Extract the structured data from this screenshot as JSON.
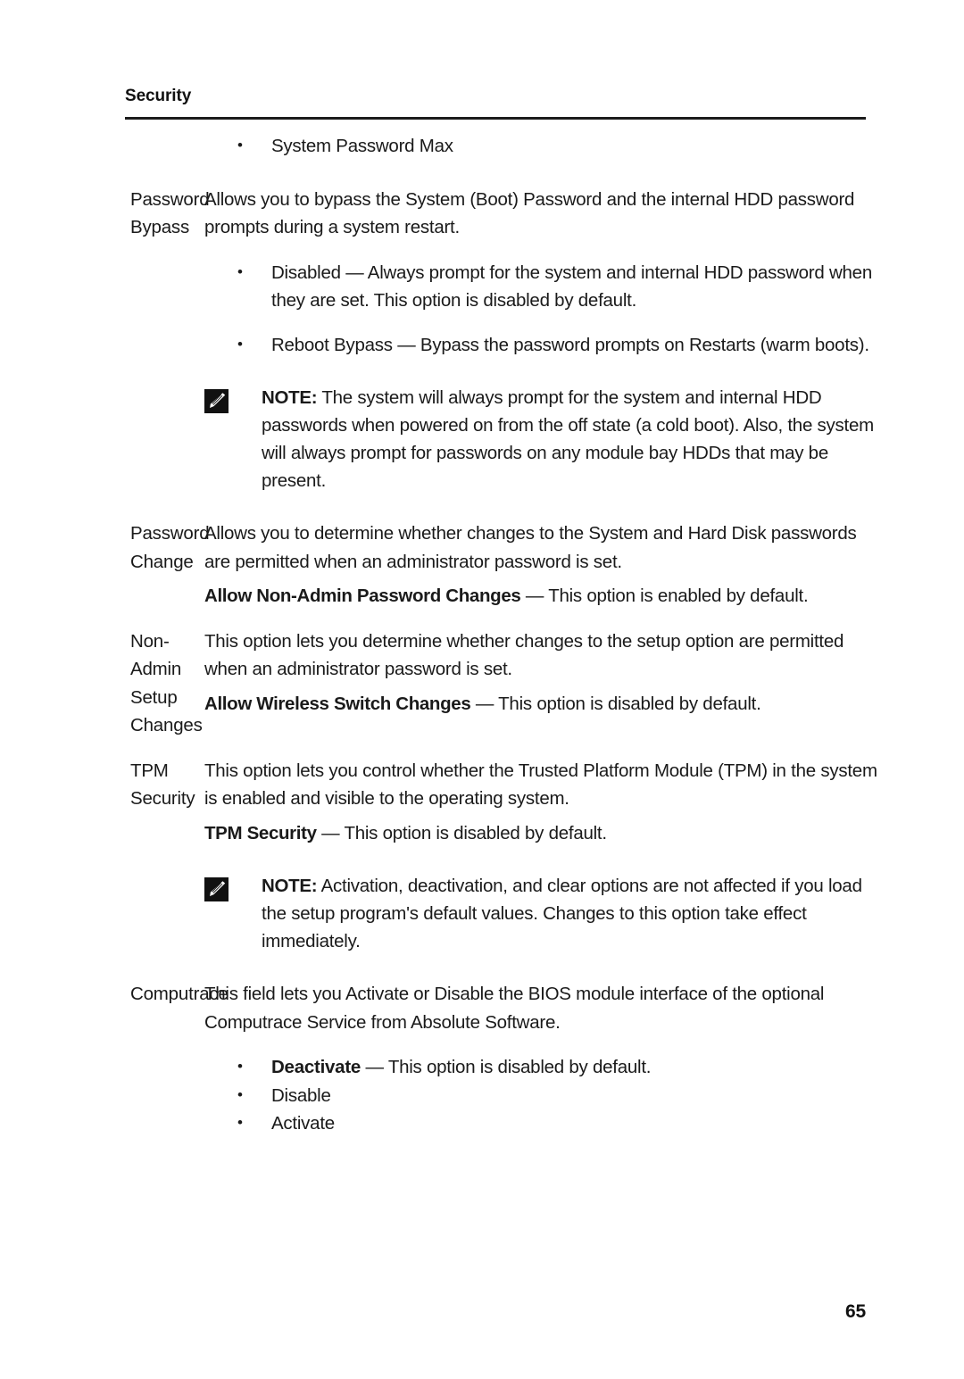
{
  "header": {
    "title": "Security"
  },
  "footer": {
    "page_number": "65"
  },
  "icons": {
    "note_icon_name": "pencil-note-icon"
  },
  "continued_bullet": {
    "text": "System Password Max"
  },
  "rows": [
    {
      "label": "Password Bypass",
      "paragraph": "Allows you to bypass the System (Boot) Password and the internal HDD password prompts during a system restart.",
      "bullets": [
        "Disabled — Always prompt for the system and internal HDD password when they are set. This option is disabled by default.",
        "Reboot Bypass — Bypass the password prompts on Restarts (warm boots)."
      ],
      "note": {
        "label": "NOTE:",
        "text": " The system will always prompt for the system and internal HDD passwords when powered on from the off state (a cold boot). Also, the system will always prompt for passwords on any module bay HDDs that may be present."
      }
    },
    {
      "label": "Password Change",
      "paragraph": "Allows you to determine whether changes to the System and Hard Disk passwords are permitted when an administrator password is set.",
      "sub_option": {
        "bold": "Allow Non-Admin Password Changes",
        "rest": " — This option is enabled by default."
      }
    },
    {
      "label": "Non-Admin Setup Changes",
      "paragraph": "This option lets you determine whether changes to the setup option are permitted when an administrator password is set.",
      "sub_option": {
        "bold": "Allow Wireless Switch Changes",
        "rest": " — This option is disabled by default."
      }
    },
    {
      "label": "TPM Security",
      "paragraph": "This option lets you control whether the Trusted Platform Module (TPM) in the system is enabled and visible to the operating system.",
      "sub_option": {
        "bold": "TPM Security",
        "rest": " — This option is disabled by default."
      },
      "note": {
        "label": "NOTE:",
        "text": " Activation, deactivation, and clear options are not affected if you load the setup program's default values. Changes to this option take effect immediately."
      }
    },
    {
      "label": "Computrace",
      "paragraph": "This field lets you Activate or Disable the BIOS module interface of the optional Computrace Service from Absolute Software.",
      "option_bullets": [
        {
          "bold": "Deactivate",
          "rest": " — This option is disabled by default."
        },
        {
          "bold": "",
          "rest": "Disable"
        },
        {
          "bold": "",
          "rest": "Activate"
        }
      ]
    }
  ]
}
